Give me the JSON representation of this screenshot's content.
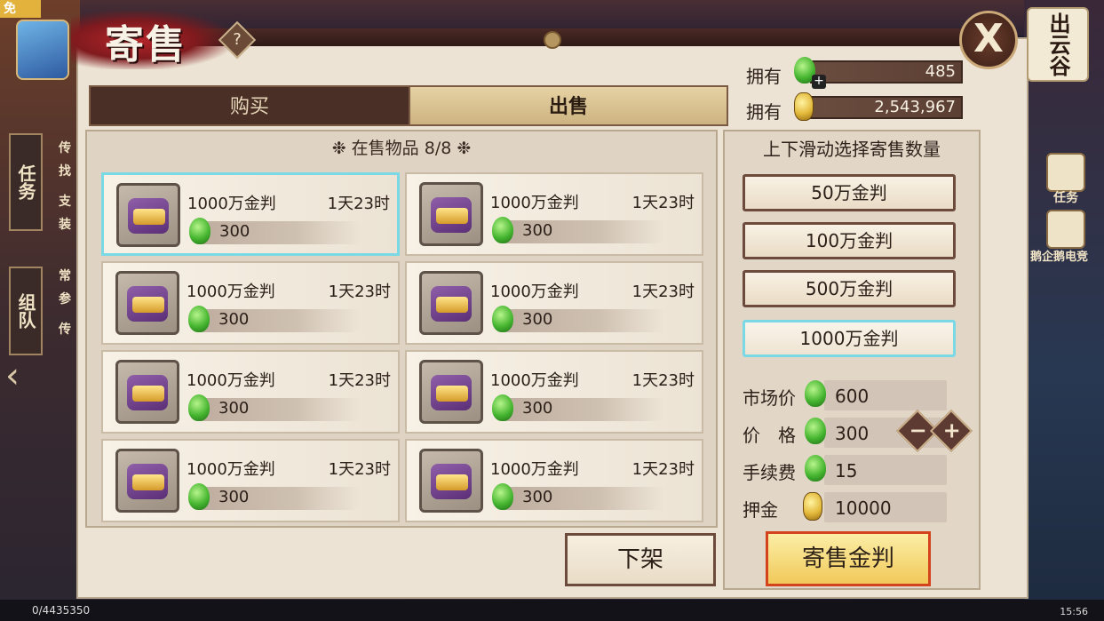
{
  "status": {
    "top_badge": "免",
    "bottom_left": "0/4435350",
    "time": "15:56"
  },
  "header": {
    "title": "寄售",
    "help": "?",
    "close": "X",
    "location": "出云谷"
  },
  "side": {
    "left": [
      {
        "label": "任务"
      },
      {
        "label": "组队"
      }
    ],
    "left_mini": [
      "传",
      "找",
      "支",
      "装",
      "常",
      "参",
      "传"
    ],
    "right": [
      {
        "label": "任务"
      },
      {
        "label": "鹅企鹅电竞"
      }
    ]
  },
  "tabs": [
    {
      "label": "购买",
      "active": false
    },
    {
      "label": "出售",
      "active": true
    }
  ],
  "currency": [
    {
      "label": "拥有",
      "icon": "jade-icon",
      "value": "485"
    },
    {
      "label": "拥有",
      "icon": "coin-icon",
      "value": "2,543,967"
    }
  ],
  "listings": {
    "header": "在售物品",
    "count": "8/8",
    "items": [
      {
        "name": "1000万金判",
        "time": "1天23时",
        "price": "300",
        "selected": true
      },
      {
        "name": "1000万金判",
        "time": "1天23时",
        "price": "300"
      },
      {
        "name": "1000万金判",
        "time": "1天23时",
        "price": "300"
      },
      {
        "name": "1000万金判",
        "time": "1天23时",
        "price": "300"
      },
      {
        "name": "1000万金判",
        "time": "1天23时",
        "price": "300"
      },
      {
        "name": "1000万金判",
        "time": "1天23时",
        "price": "300"
      },
      {
        "name": "1000万金判",
        "time": "1天23时",
        "price": "300"
      },
      {
        "name": "1000万金判",
        "time": "1天23时",
        "price": "300"
      }
    ]
  },
  "quantity": {
    "title": "上下滑动选择寄售数量",
    "options": [
      {
        "label": "50万金判"
      },
      {
        "label": "100万金判"
      },
      {
        "label": "500万金判"
      },
      {
        "label": "1000万金判",
        "selected": true
      }
    ]
  },
  "info": {
    "market_label": "市场价",
    "market_value": "600",
    "price_label": "价　格",
    "price_value": "300",
    "fee_label": "手续费",
    "fee_value": "15",
    "deposit_label": "押金",
    "deposit_value": "10000",
    "minus": "−",
    "plus": "+"
  },
  "actions": {
    "unlist": "下架",
    "sell": "寄售金判"
  },
  "colors": {
    "accent_selected": "#7ad9e4",
    "sell_border": "#d2431e",
    "jade": "#45b52f",
    "coin": "#e3b93b"
  }
}
